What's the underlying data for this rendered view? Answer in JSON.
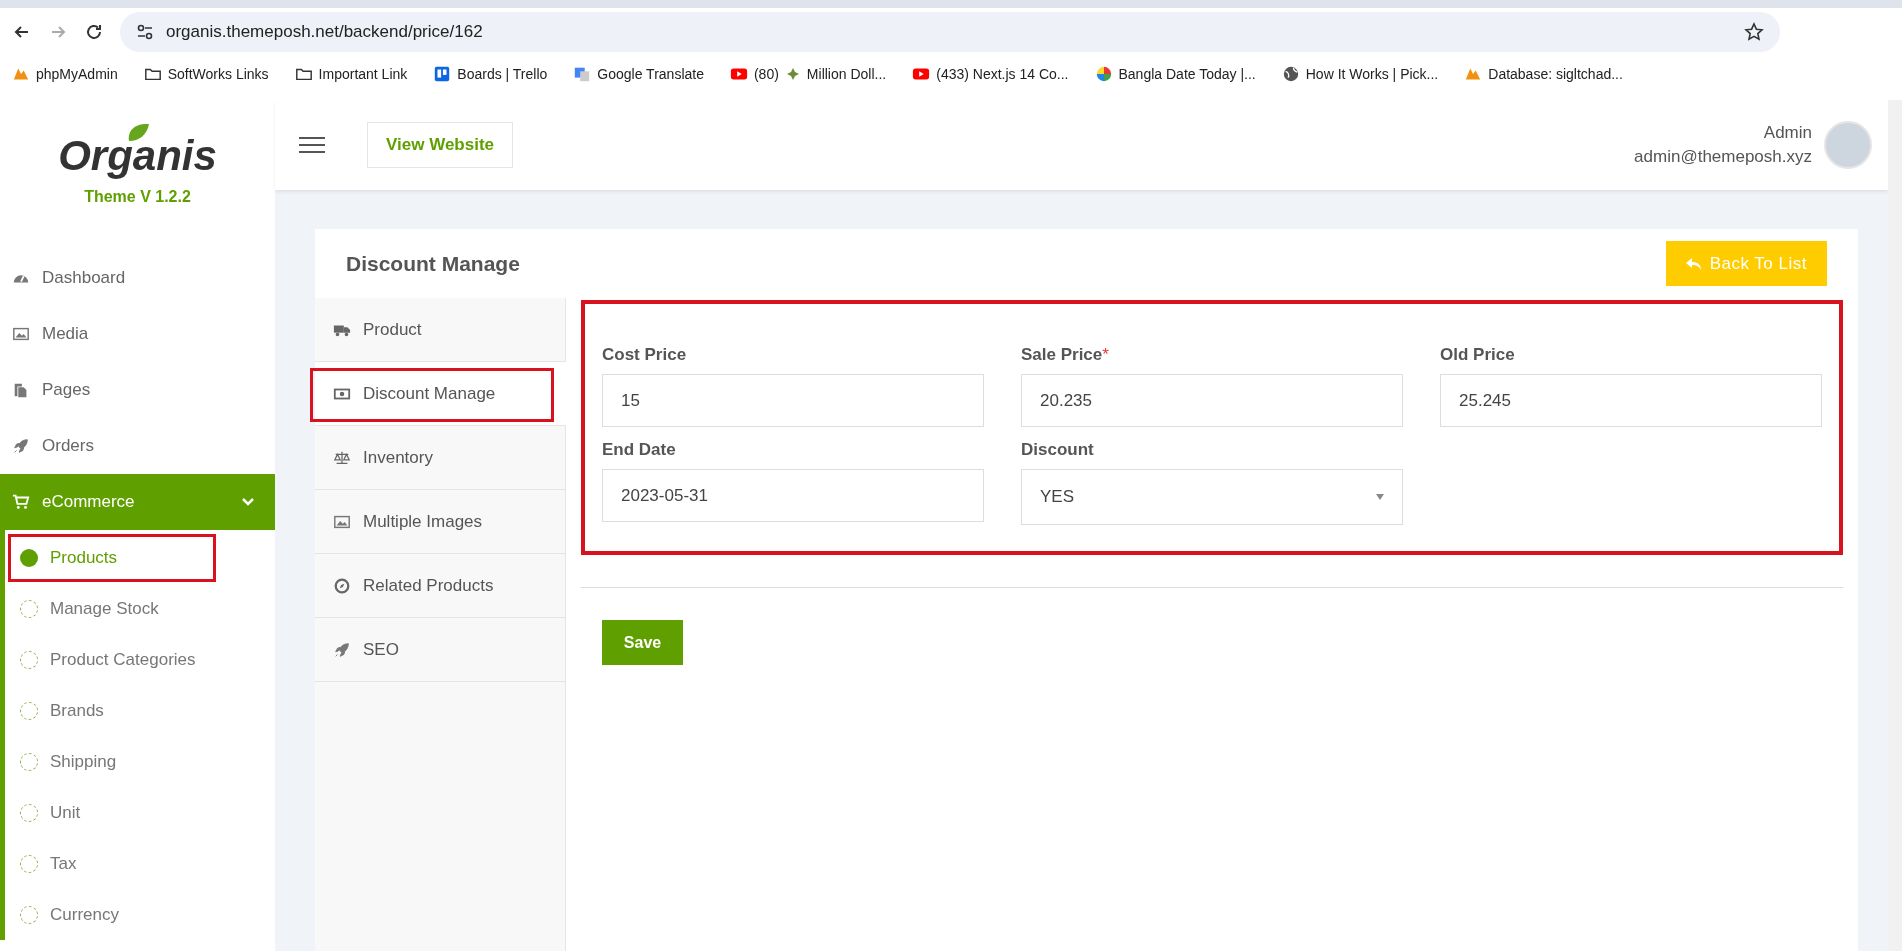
{
  "browser": {
    "url": "organis.themeposh.net/backend/price/162",
    "bookmarks": [
      {
        "parts": [
          "phpMyAdmin"
        ]
      },
      {
        "parts": [
          "SoftWorks Links"
        ]
      },
      {
        "parts": [
          "Important Link"
        ]
      },
      {
        "parts": [
          "Boards | Trello"
        ]
      },
      {
        "parts": [
          "Google Translate"
        ]
      },
      {
        "parts": [
          "(80)",
          "Million Doll..."
        ]
      },
      {
        "parts": [
          "(433) Next.js 14 Co..."
        ]
      },
      {
        "parts": [
          "Bangla Date Today |..."
        ]
      },
      {
        "parts": [
          "How It Works | Pick..."
        ]
      },
      {
        "parts": [
          "Database: sigltchad..."
        ]
      }
    ]
  },
  "sidebar": {
    "logo": "Organis",
    "version": "Theme V 1.2.2",
    "items": [
      {
        "label": "Dashboard",
        "selected": false
      },
      {
        "label": "Media",
        "selected": false
      },
      {
        "label": "Pages",
        "selected": false
      },
      {
        "label": "Orders",
        "selected": false
      },
      {
        "label": "eCommerce",
        "expanded": true,
        "selected": true,
        "children": [
          {
            "label": "Products",
            "selected": true,
            "highlighted": true
          },
          {
            "label": "Manage Stock",
            "selected": false,
            "highlighted": false
          },
          {
            "label": "Product Categories",
            "selected": false,
            "highlighted": false
          },
          {
            "label": "Brands",
            "selected": false,
            "highlighted": false
          },
          {
            "label": "Shipping",
            "selected": false,
            "highlighted": false
          },
          {
            "label": "Unit",
            "selected": false,
            "highlighted": false
          },
          {
            "label": "Tax",
            "selected": false,
            "highlighted": false
          },
          {
            "label": "Currency",
            "selected": false,
            "highlighted": false
          }
        ]
      }
    ]
  },
  "header": {
    "view_website": "View Website",
    "user_name": "Admin",
    "user_email": "admin@themeposh.xyz"
  },
  "card": {
    "title": "Discount Manage",
    "back_button": "Back To List",
    "tabs": [
      {
        "label": "Product",
        "selected": false,
        "highlighted": false
      },
      {
        "label": "Discount Manage",
        "selected": true,
        "highlighted": true
      },
      {
        "label": "Inventory",
        "selected": false,
        "highlighted": false
      },
      {
        "label": "Multiple Images",
        "selected": false,
        "highlighted": false
      },
      {
        "label": "Related Products",
        "selected": false,
        "highlighted": false
      },
      {
        "label": "SEO",
        "selected": false,
        "highlighted": false
      }
    ],
    "form_highlighted": true,
    "fields": [
      {
        "kind": "text",
        "label": "Cost Price",
        "value": "15"
      },
      {
        "kind": "text",
        "label": "Sale Price",
        "required_mark": "*",
        "value": "20.235"
      },
      {
        "kind": "text",
        "label": "Old Price",
        "value": "25.245"
      },
      {
        "kind": "text",
        "label": "End Date",
        "value": "2023-05-31"
      },
      {
        "kind": "select",
        "label": "Discount",
        "value": "YES"
      }
    ],
    "save_button": "Save"
  }
}
